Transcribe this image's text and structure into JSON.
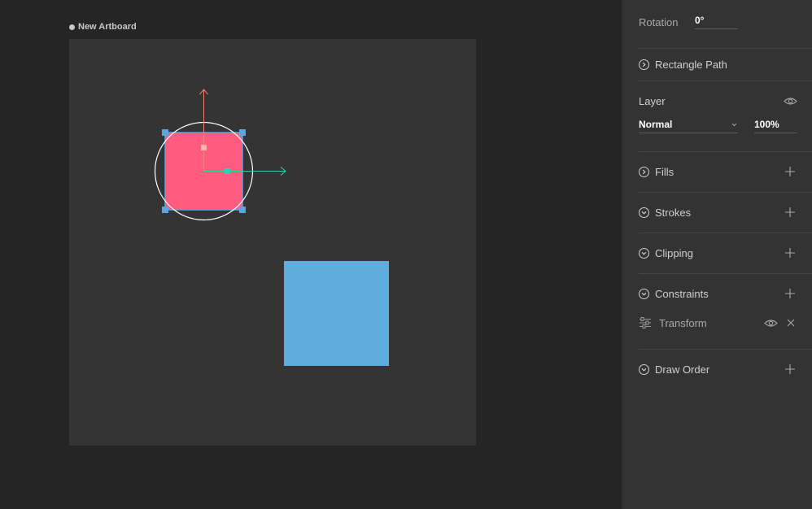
{
  "artboard": {
    "name": "New Artboard"
  },
  "colors": {
    "background": "#252525",
    "artboard": "#343434",
    "pink_shape": "#ff5c7f",
    "blue_shape": "#61acdf",
    "selection": "#5aa7e0",
    "y_axis": "#f08080",
    "x_axis": "#2fd3b0",
    "panel": "#333333"
  },
  "inspector": {
    "rotation_label": "Rotation",
    "rotation_value": "0°",
    "rectangle_path": "Rectangle Path",
    "layer_label": "Layer",
    "blend_mode": "Normal",
    "opacity": "100%",
    "fills": "Fills",
    "strokes": "Strokes",
    "clipping": "Clipping",
    "constraints": "Constraints",
    "transform": "Transform",
    "draw_order": "Draw Order"
  }
}
